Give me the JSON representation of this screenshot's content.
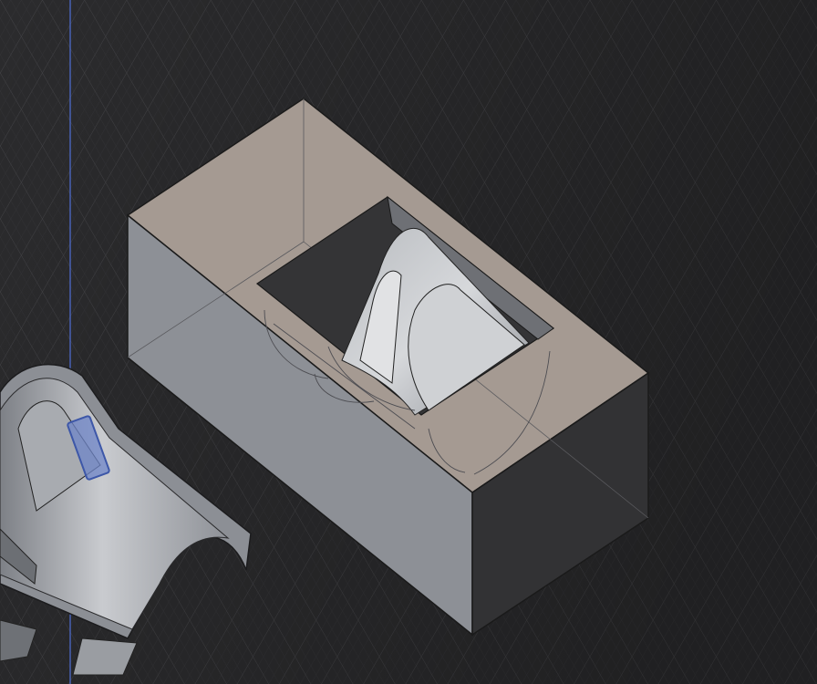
{
  "viewport": {
    "background_color": "#2b2b2d",
    "grid_color": "#4a4a4e",
    "grid_minor_color": "#38383b",
    "axis_line_color": "#4f6fd6"
  },
  "scene": {
    "mold_block": {
      "top_color": "#a59a92",
      "left_face_color": "#8d9096",
      "right_face_color": "#323234",
      "edge_color": "#1a1a1a",
      "cavity_color": "#343436"
    },
    "cast_part": {
      "body_color": "#9c9fa4",
      "highlight_color": "#c6c8cc",
      "selection_color": "#6f86c8"
    }
  }
}
